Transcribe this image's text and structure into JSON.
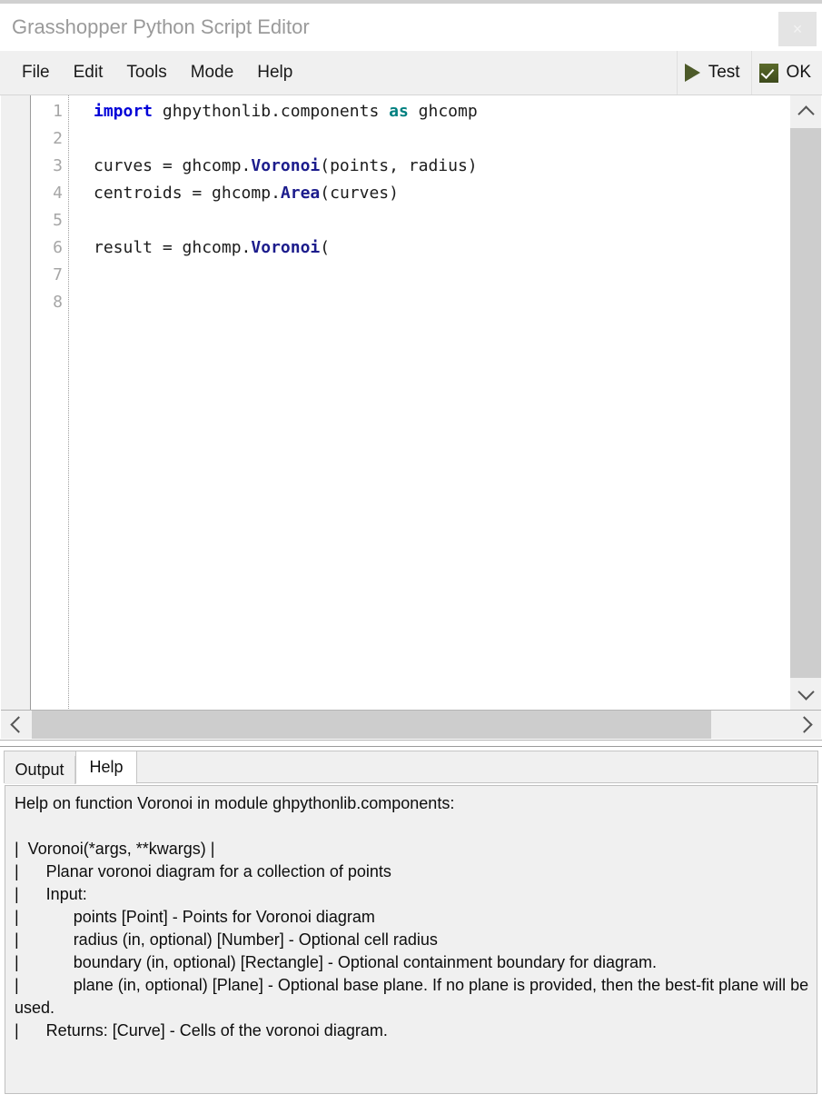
{
  "window": {
    "title": "Grasshopper Python Script Editor",
    "close_label": "×"
  },
  "menubar": {
    "items": [
      {
        "label": "File"
      },
      {
        "label": "Edit"
      },
      {
        "label": "Tools"
      },
      {
        "label": "Mode"
      },
      {
        "label": "Help"
      }
    ],
    "actions": [
      {
        "label": "Test",
        "icon": "play-icon"
      },
      {
        "label": "OK",
        "icon": "checkbox-checked-icon"
      }
    ]
  },
  "editor": {
    "line_numbers": [
      "1",
      "2",
      "3",
      "4",
      "5",
      "6",
      "7",
      "8"
    ],
    "code_html": "<span class=\"k-import\">import</span> ghpythonlib.components <span class=\"k-as\">as</span> ghcomp\n\ncurves = ghcomp.<span class=\"k-fn\">Voronoi</span>(points, radius)\ncentroids = ghcomp.<span class=\"k-fn\">Area</span>(curves)\n\nresult = ghcomp.<span class=\"k-fn\">Voronoi</span>(\n\n",
    "code_plain": [
      "import ghpythonlib.components as ghcomp",
      "",
      "curves = ghcomp.Voronoi(points, radius)",
      "centroids = ghcomp.Area(curves)",
      "",
      "result = ghcomp.Voronoi(",
      "",
      ""
    ],
    "syntax_colors": {
      "keyword_import": "#0000d8",
      "keyword_as": "#008080",
      "function": "#1c1c8c",
      "plain": "#1c1c1c",
      "line_number": "#a6a6a6"
    }
  },
  "bottom_panel": {
    "tabs": [
      {
        "label": "Output",
        "selected": false
      },
      {
        "label": "Help",
        "selected": true
      }
    ],
    "help_text": "Help on function Voronoi in module ghpythonlib.components:\n\n|  Voronoi(*args, **kwargs) |\n|      Planar voronoi diagram for a collection of points\n|      Input:\n|            points [Point] - Points for Voronoi diagram\n|            radius (in, optional) [Number] - Optional cell radius\n|            boundary (in, optional) [Rectangle] - Optional containment boundary for diagram.\n|            plane (in, optional) [Plane] - Optional base plane. If no plane is provided, then the best-fit plane will be used.\n|      Returns: [Curve] - Cells of the voronoi diagram."
  },
  "theme": {
    "chrome_bg": "#f0f0f0",
    "editor_bg": "#ffffff",
    "scrollbar_thumb": "#cdcdcd",
    "title_color": "#9a9a9a",
    "play_green": "#4d5a29"
  }
}
